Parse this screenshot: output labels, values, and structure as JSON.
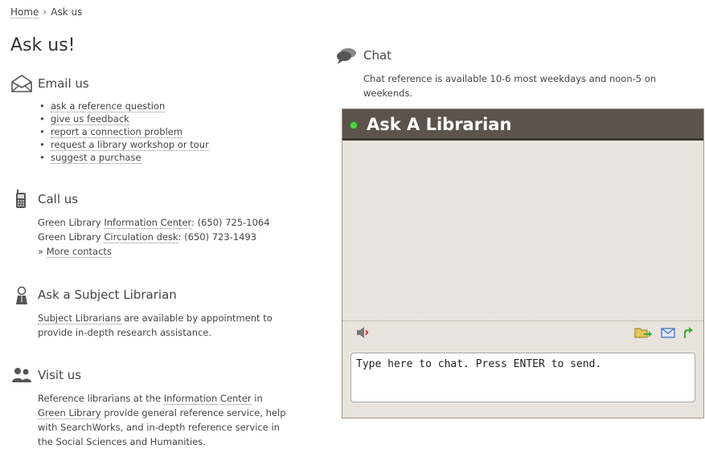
{
  "breadcrumb": {
    "home": "Home",
    "separator": "›",
    "current": "Ask us"
  },
  "page_title": "Ask us!",
  "email": {
    "heading": "Email us",
    "icon": "envelope-icon",
    "links": [
      "ask a reference question",
      "give us feedback",
      "report a connection problem",
      "request a library workshop or tour",
      "suggest a purchase"
    ]
  },
  "call": {
    "heading": "Call us",
    "icon": "phone-icon",
    "line1_prefix": "Green Library ",
    "line1_link": "Information Center",
    "line1_suffix": ": (650) 725-1064",
    "line2_prefix": "Green Library ",
    "line2_link": "Circulation desk",
    "line2_suffix": ": (650) 723-1493",
    "more_prefix": "» ",
    "more_link": "More contacts"
  },
  "subject": {
    "heading": "Ask a Subject Librarian",
    "icon": "person-icon",
    "link": "Subject Librarians",
    "text1": " are available by appointment to",
    "text2": "provide in-depth research assistance."
  },
  "visit": {
    "heading": "Visit us",
    "icon": "people-icon",
    "t1": "Reference librarians at the ",
    "l1": "Information Center",
    "t2": " in",
    "l2": "Green Library",
    "t3": " provide general reference service, help",
    "t4": "with SearchWorks, and in-depth reference service in",
    "t5": "the Social Sciences and Humanities."
  },
  "chat": {
    "heading": "Chat",
    "icon": "speech-bubbles-icon",
    "availability": "Chat reference is available 10-6 most weekdays and noon-5 on weekends.",
    "widget_title": "Ask A Librarian",
    "input_placeholder": "Type here to chat. Press ENTER to send.",
    "tool_icons": [
      "speaker-icon",
      "folder-send-icon",
      "email-icon",
      "redo-arrow-icon"
    ],
    "status_color": "#4fd43f"
  },
  "colors": {
    "header_bg": "#5c544c",
    "widget_bg": "#e8e3dc"
  }
}
